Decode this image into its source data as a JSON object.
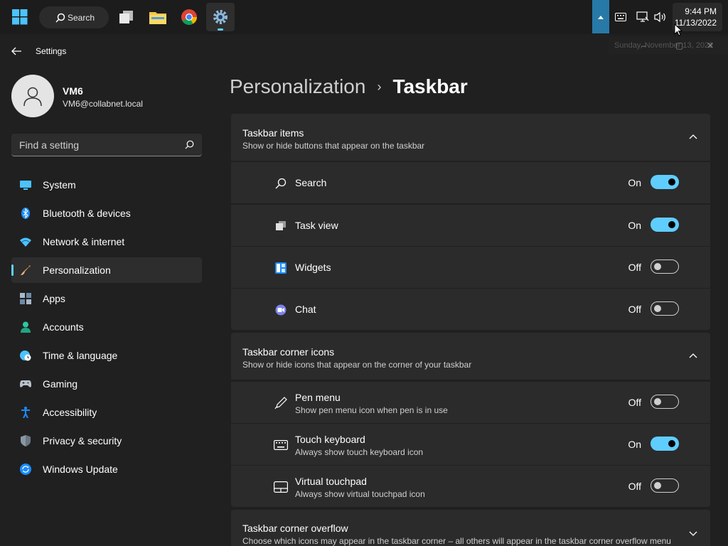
{
  "taskbar": {
    "search_label": "Search",
    "clock_time": "9:44 PM",
    "clock_date": "11/13/2022",
    "date_tooltip": "Sunday, November 13, 2022"
  },
  "window": {
    "title": "Settings"
  },
  "profile": {
    "name": "VM6",
    "email": "VM6@collabnet.local"
  },
  "find": {
    "placeholder": "Find a setting"
  },
  "nav": [
    {
      "label": "System",
      "icon": "monitor-icon"
    },
    {
      "label": "Bluetooth & devices",
      "icon": "bluetooth-icon"
    },
    {
      "label": "Network & internet",
      "icon": "wifi-icon"
    },
    {
      "label": "Personalization",
      "icon": "brush-icon",
      "selected": true
    },
    {
      "label": "Apps",
      "icon": "apps-icon"
    },
    {
      "label": "Accounts",
      "icon": "person-icon"
    },
    {
      "label": "Time & language",
      "icon": "globe-clock-icon"
    },
    {
      "label": "Gaming",
      "icon": "controller-icon"
    },
    {
      "label": "Accessibility",
      "icon": "accessibility-icon"
    },
    {
      "label": "Privacy & security",
      "icon": "shield-icon"
    },
    {
      "label": "Windows Update",
      "icon": "update-icon"
    }
  ],
  "breadcrumb": {
    "parent": "Personalization",
    "separator": "›",
    "current": "Taskbar"
  },
  "sections": {
    "items": {
      "title": "Taskbar items",
      "subtitle": "Show or hide buttons that appear on the taskbar",
      "rows": [
        {
          "label": "Search",
          "state": "On"
        },
        {
          "label": "Task view",
          "state": "On"
        },
        {
          "label": "Widgets",
          "state": "Off"
        },
        {
          "label": "Chat",
          "state": "Off"
        }
      ]
    },
    "corner": {
      "title": "Taskbar corner icons",
      "subtitle": "Show or hide icons that appear on the corner of your taskbar",
      "rows": [
        {
          "label": "Pen menu",
          "sub": "Show pen menu icon when pen is in use",
          "state": "Off"
        },
        {
          "label": "Touch keyboard",
          "sub": "Always show touch keyboard icon",
          "state": "On"
        },
        {
          "label": "Virtual touchpad",
          "sub": "Always show virtual touchpad icon",
          "state": "Off"
        }
      ]
    },
    "overflow": {
      "title": "Taskbar corner overflow",
      "subtitle": "Choose which icons may appear in the taskbar corner – all others will appear in the taskbar corner overflow menu"
    }
  },
  "colors": {
    "accent": "#60cdff",
    "background": "#202020",
    "card": "#2b2b2b"
  }
}
